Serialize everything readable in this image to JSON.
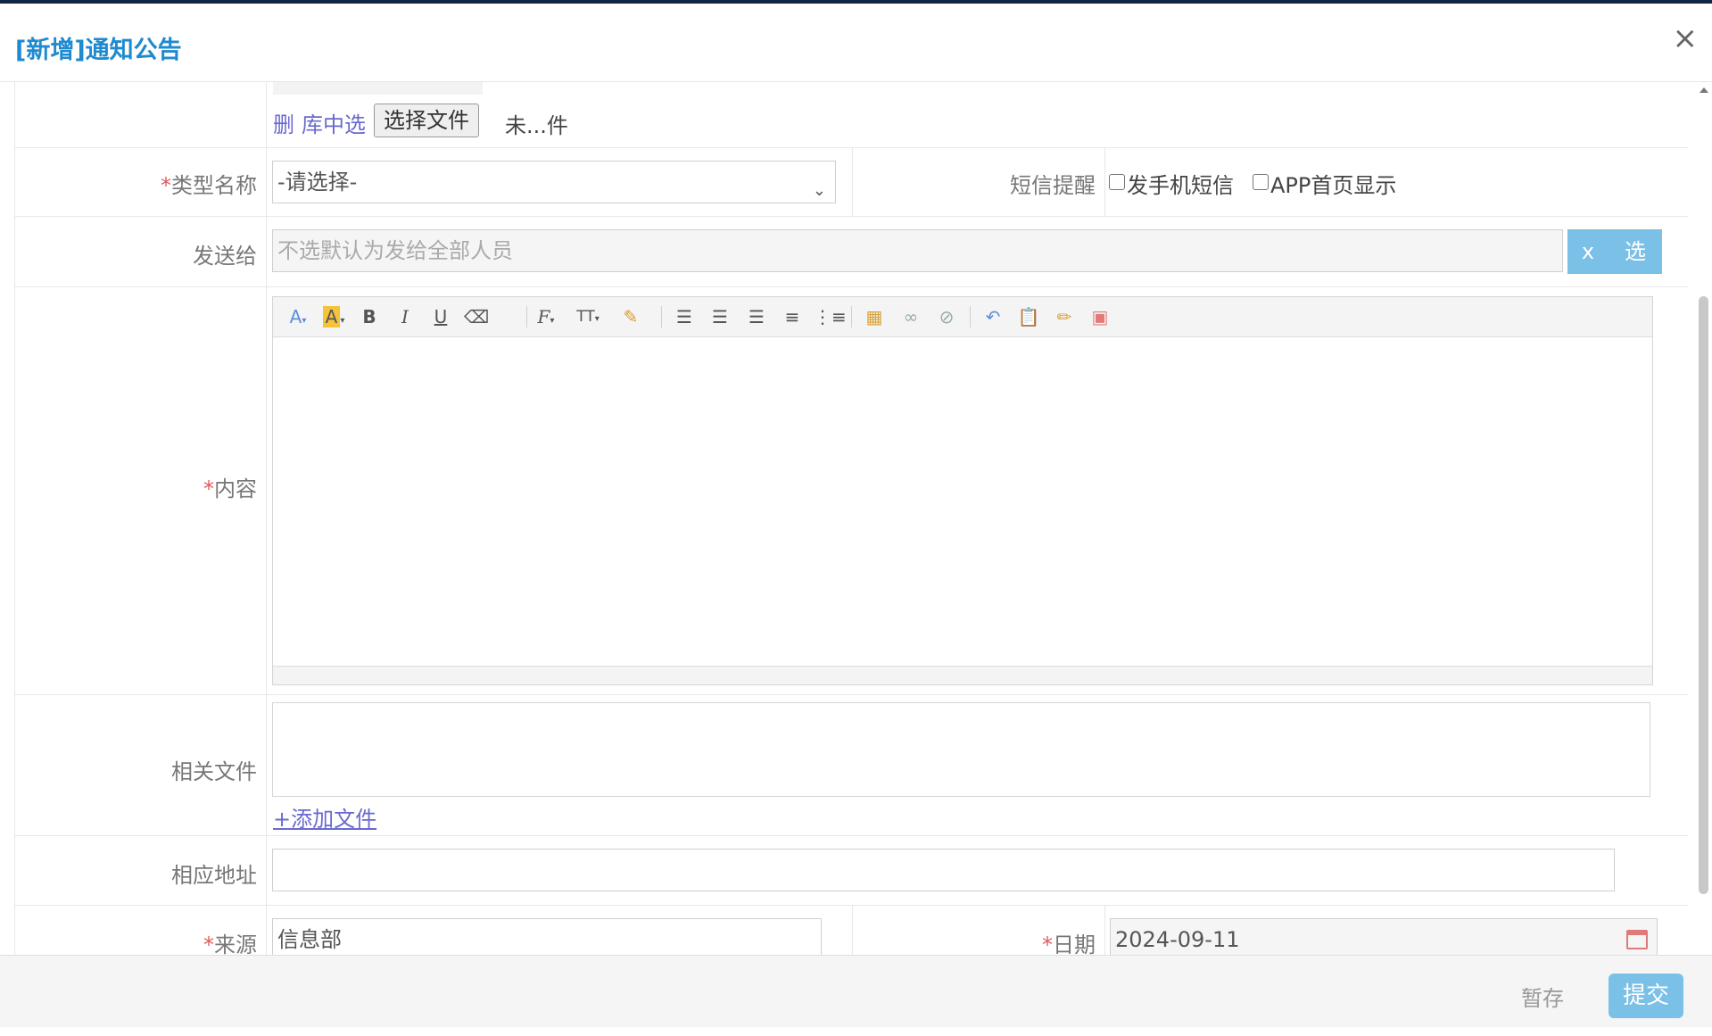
{
  "dialog": {
    "title": "[新增]通知公告",
    "close_glyph": "×"
  },
  "attachment_row": {
    "delete_link": "删",
    "library_link": "库中选",
    "choose_file_label": "选择文件",
    "file_status": "未...件"
  },
  "type_row": {
    "required_mark": "*",
    "label": "类型名称",
    "select_value": "-请选择-",
    "sms_label": "短信提醒",
    "sms_checkbox_label": "发手机短信",
    "app_checkbox_label": "APP首页显示"
  },
  "send_row": {
    "label": "发送给",
    "placeholder": "不选默认为发给全部人员",
    "clear_button": "x",
    "select_button": "选"
  },
  "content_row": {
    "required_mark": "*",
    "label": "内容",
    "toolbar_icons": [
      "font-color-icon",
      "highlight-icon",
      "bold-icon",
      "italic-icon",
      "underline-icon",
      "eraser-icon",
      "font-family-icon",
      "font-size-icon",
      "format-paint-icon",
      "align-left-icon",
      "align-center-icon",
      "align-right-icon",
      "ordered-list-icon",
      "unordered-list-icon",
      "insert-image-icon",
      "link-icon",
      "unlink-icon",
      "undo-icon",
      "paste-icon",
      "clear-format-icon",
      "fullscreen-icon"
    ]
  },
  "files_row": {
    "label": "相关文件",
    "add_link": "+添加文件"
  },
  "address_row": {
    "label": "相应地址",
    "value": ""
  },
  "source_row": {
    "required_mark": "*",
    "label": "来源",
    "value": "信息部",
    "date_label": "日期",
    "date_value": "2024-09-11"
  },
  "footer": {
    "save_draft": "暂存",
    "submit": "提交"
  },
  "colors": {
    "title": "#1f8ad0",
    "accent_button": "#7bc0e6",
    "required": "#e05a5a",
    "link": "#6a6acf"
  }
}
